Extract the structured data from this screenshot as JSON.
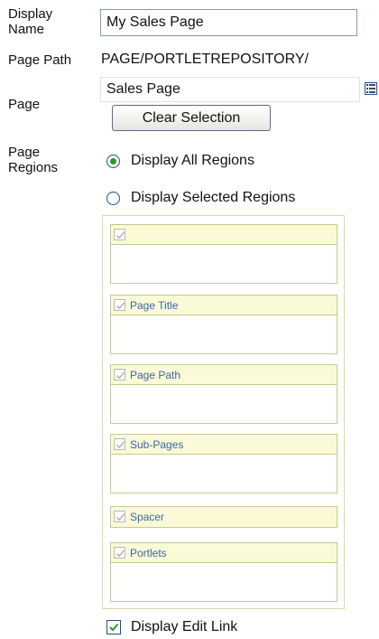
{
  "form": {
    "display_name": {
      "label_line1": "Display",
      "label_line2": "Name",
      "value": "My Sales Page"
    },
    "page_path": {
      "label": "Page Path",
      "value": "PAGE/PORTLETREPOSITORY/"
    },
    "page": {
      "label": "Page",
      "value": "Sales Page",
      "clear_button": "Clear Selection",
      "picker_icon": "list-icon"
    },
    "page_regions": {
      "label_line1": "Page",
      "label_line2": "Regions",
      "option_all": "Display All Regions",
      "option_selected": "Display Selected Regions",
      "selected_option": "all"
    },
    "regions": [
      {
        "title": "",
        "checked": true
      },
      {
        "title": "Page Title",
        "checked": true
      },
      {
        "title": "Page Path",
        "checked": true
      },
      {
        "title": "Sub-Pages",
        "checked": true
      },
      {
        "title": "Spacer",
        "checked": true
      },
      {
        "title": "Portlets",
        "checked": true
      }
    ],
    "display_edit_link": {
      "label": "Display Edit Link",
      "checked": true
    }
  },
  "colors": {
    "region_header": "#fafad6",
    "region_border": "#c8c890",
    "region_title": "#3a66a8",
    "radio_selected": "#2b9a2b",
    "check_mark": "#2b9a2b"
  }
}
